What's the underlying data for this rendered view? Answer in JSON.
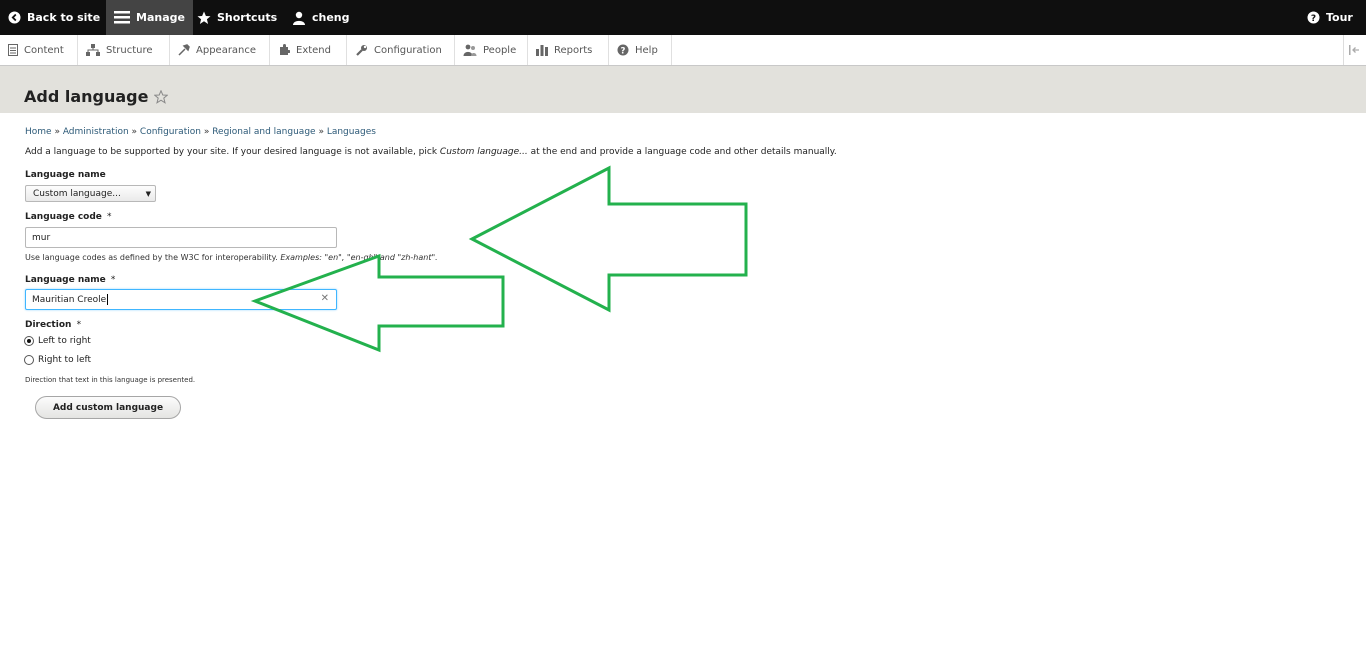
{
  "toolbar": {
    "back_label": "Back to site",
    "manage_label": "Manage",
    "shortcuts_label": "Shortcuts",
    "user_label": "cheng",
    "tour_label": "Tour"
  },
  "tray": {
    "items": [
      {
        "label": "Content",
        "icon": "content-icon"
      },
      {
        "label": "Structure",
        "icon": "structure-icon"
      },
      {
        "label": "Appearance",
        "icon": "appearance-icon"
      },
      {
        "label": "Extend",
        "icon": "extend-icon"
      },
      {
        "label": "Configuration",
        "icon": "configuration-icon"
      },
      {
        "label": "People",
        "icon": "people-icon"
      },
      {
        "label": "Reports",
        "icon": "reports-icon"
      },
      {
        "label": "Help",
        "icon": "help-icon"
      }
    ]
  },
  "page": {
    "title": "Add language",
    "breadcrumb": [
      "Home",
      "Administration",
      "Configuration",
      "Regional and language",
      "Languages"
    ],
    "breadcrumb_sep": " » ",
    "description_pre": "Add a language to be supported by your site. If your desired language is not available, pick ",
    "description_em": "Custom language...",
    "description_post": " at the end and provide a language code and other details manually."
  },
  "form": {
    "language_select_label": "Language name",
    "language_select_value": "Custom language...",
    "langcode_label": "Language code",
    "langcode_value": "mur",
    "langcode_help_pre": "Use language codes as defined by the W3C for interoperability. ",
    "langcode_help_em": "Examples: \"en\", \"en-gb\" and \"zh-hant\".",
    "name_label": "Language name",
    "name_value": "Mauritian Creole",
    "required_mark": "*",
    "direction_label": "Direction",
    "direction_options": [
      "Left to right",
      "Right to left"
    ],
    "direction_help": "Direction that text in this language is presented.",
    "submit_label": "Add custom language"
  },
  "colors": {
    "toolbar_bg": "#0f0f0f",
    "header_bg": "#e2e1dc",
    "link": "#2d5a78",
    "annotation_arrow": "#23b14d"
  }
}
